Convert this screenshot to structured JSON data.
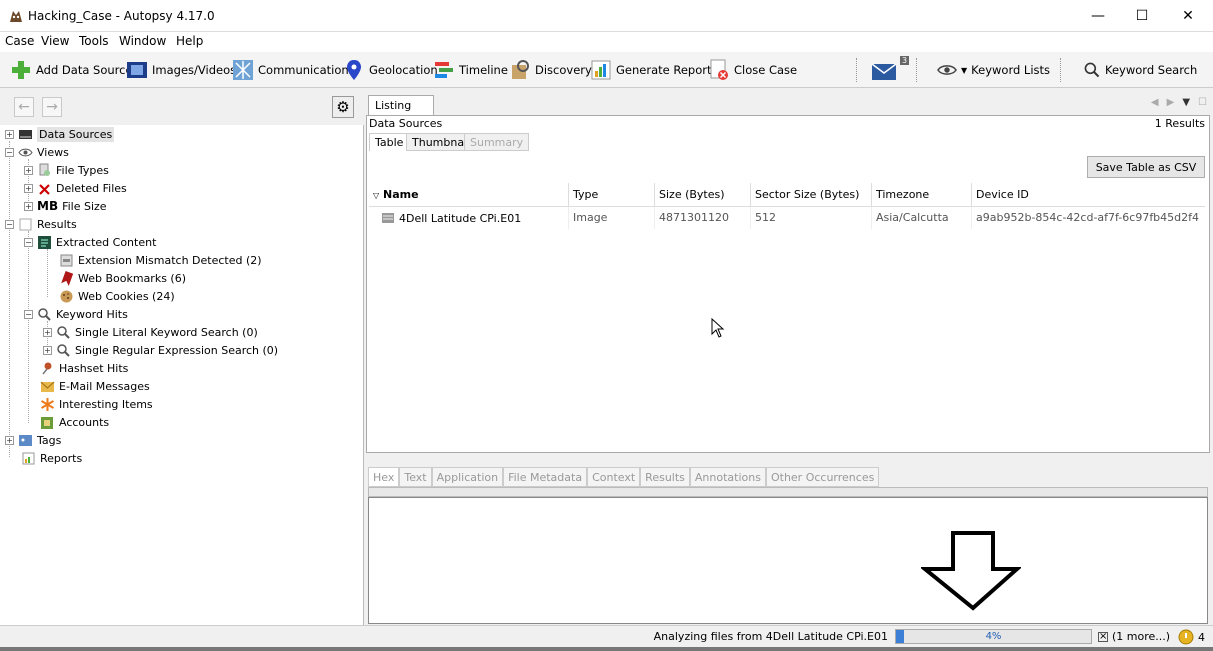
{
  "window": {
    "title": "Hacking_Case - Autopsy 4.17.0",
    "minimize": "—",
    "maximize": "☐",
    "close": "✕"
  },
  "menu": [
    "Case",
    "View",
    "Tools",
    "Window",
    "Help"
  ],
  "toolbar": {
    "add_data_source": "Add Data Source",
    "images_videos": "Images/Videos",
    "communications": "Communications",
    "geolocation": "Geolocation",
    "timeline": "Timeline",
    "discovery": "Discovery",
    "generate_report": "Generate Report",
    "close_case": "Close Case",
    "mail_badge": "3",
    "keyword_lists": "Keyword Lists",
    "keyword_search": "Keyword Search"
  },
  "tree": {
    "data_sources": "Data Sources",
    "views": "Views",
    "file_types": "File Types",
    "deleted_files": "Deleted Files",
    "file_size_mb": "MB",
    "file_size": "File Size",
    "results": "Results",
    "extracted_content": "Extracted Content",
    "extension_mismatch": "Extension Mismatch Detected (2)",
    "web_bookmarks": "Web Bookmarks (6)",
    "web_cookies": "Web Cookies (24)",
    "keyword_hits": "Keyword Hits",
    "single_literal": "Single Literal Keyword Search (0)",
    "single_regex": "Single Regular Expression Search (0)",
    "hashset_hits": "Hashset Hits",
    "email_messages": "E-Mail Messages",
    "interesting_items": "Interesting Items",
    "accounts": "Accounts",
    "tags": "Tags",
    "reports": "Reports"
  },
  "listing": {
    "tab": "Listing",
    "breadcrumb": "Data Sources",
    "results_count": "1  Results",
    "subtabs": [
      "Table",
      "Thumbnail",
      "Summary"
    ],
    "save_csv": "Save Table as CSV",
    "columns": [
      "Name",
      "Type",
      "Size (Bytes)",
      "Sector Size (Bytes)",
      "Timezone",
      "Device ID"
    ],
    "rows": [
      [
        "4Dell Latitude CPi.E01",
        "Image",
        "4871301120",
        "512",
        "Asia/Calcutta",
        "a9ab952b-854c-42cd-af7f-6c97fb45d2f4"
      ]
    ]
  },
  "viewer_tabs": [
    "Hex",
    "Text",
    "Application",
    "File Metadata",
    "Context",
    "Results",
    "Annotations",
    "Other Occurrences"
  ],
  "status": {
    "message": "Analyzing files from 4Dell Latitude CPi.E01",
    "progress_label": "4%",
    "progress": 0.04,
    "more": "(1 more...)",
    "notifications": "4"
  },
  "colors": {
    "accent": "#3c7fd6",
    "deleted_red": "#cc0000",
    "bookmark_red": "#b01818"
  }
}
